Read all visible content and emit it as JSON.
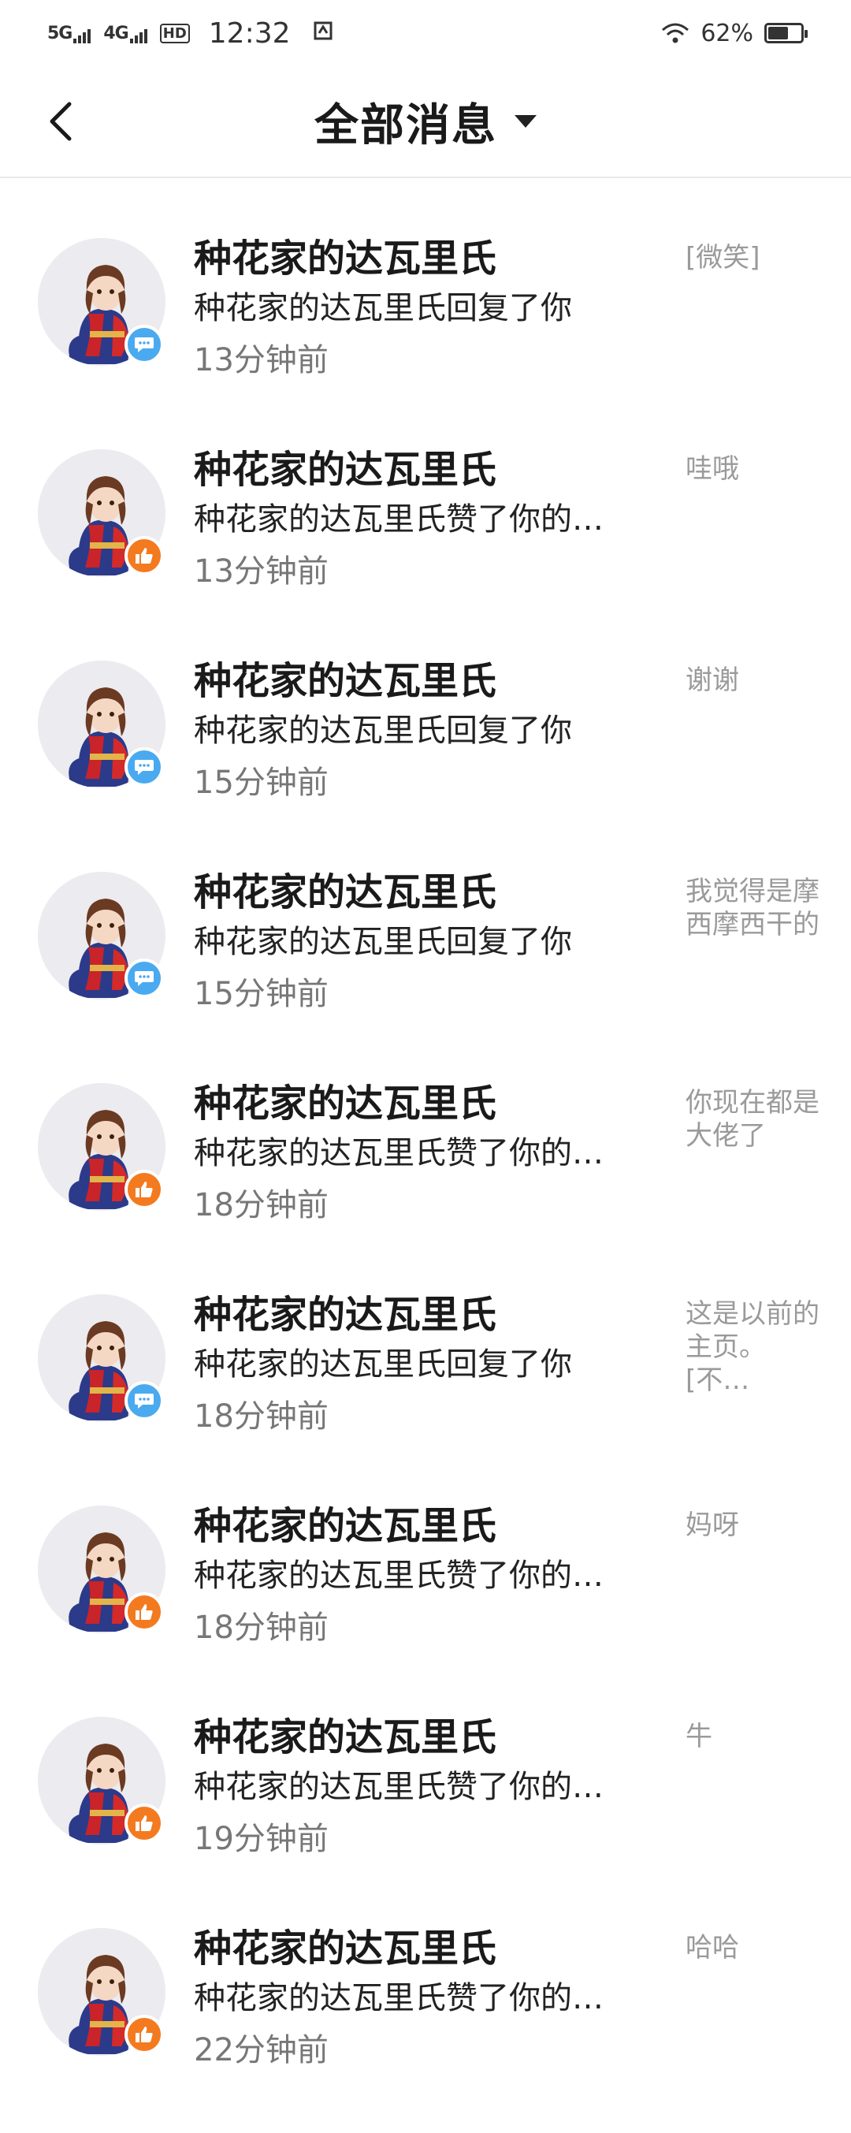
{
  "status_bar": {
    "network1": "5G",
    "network2": "4G",
    "hd": "HD",
    "time": "12:32",
    "battery": "62%",
    "battery_level": 0.62
  },
  "header": {
    "title": "全部消息"
  },
  "messages": [
    {
      "name": "种花家的达瓦里氏",
      "action": "种花家的达瓦里氏回复了你",
      "time": "13分钟前",
      "preview": "[微笑]",
      "type": "reply"
    },
    {
      "name": "种花家的达瓦里氏",
      "action": "种花家的达瓦里氏赞了你的…",
      "time": "13分钟前",
      "preview": "哇哦",
      "type": "like"
    },
    {
      "name": "种花家的达瓦里氏",
      "action": "种花家的达瓦里氏回复了你",
      "time": "15分钟前",
      "preview": "谢谢",
      "type": "reply"
    },
    {
      "name": "种花家的达瓦里氏",
      "action": "种花家的达瓦里氏回复了你",
      "time": "15分钟前",
      "preview": "我觉得是摩西摩西干的",
      "type": "reply"
    },
    {
      "name": "种花家的达瓦里氏",
      "action": "种花家的达瓦里氏赞了你的…",
      "time": "18分钟前",
      "preview": "你现在都是大佬了",
      "type": "like"
    },
    {
      "name": "种花家的达瓦里氏",
      "action": "种花家的达瓦里氏回复了你",
      "time": "18分钟前",
      "preview": "这是以前的主页。[不…",
      "type": "reply"
    },
    {
      "name": "种花家的达瓦里氏",
      "action": "种花家的达瓦里氏赞了你的…",
      "time": "18分钟前",
      "preview": "妈呀",
      "type": "like"
    },
    {
      "name": "种花家的达瓦里氏",
      "action": "种花家的达瓦里氏赞了你的…",
      "time": "19分钟前",
      "preview": "牛",
      "type": "like"
    },
    {
      "name": "种花家的达瓦里氏",
      "action": "种花家的达瓦里氏赞了你的…",
      "time": "22分钟前",
      "preview": "哈哈",
      "type": "like"
    }
  ],
  "colors": {
    "reply_badge": "#4aaaf0",
    "like_badge": "#f47a1f"
  }
}
